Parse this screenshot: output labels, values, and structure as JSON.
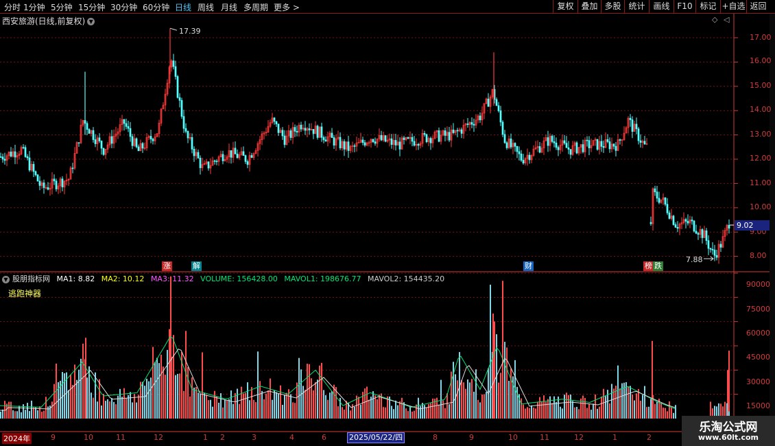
{
  "toolbar": {
    "periods": [
      "分时",
      "1分钟",
      "5分钟",
      "15分钟",
      "30分钟",
      "60分钟",
      "日线",
      "周线",
      "月线",
      "多周期",
      "更多 >"
    ],
    "active_period": "日线",
    "actions": [
      "复权",
      "叠加",
      "多股",
      "统计",
      "画线",
      "F10",
      "标记",
      "+自选",
      "返回"
    ]
  },
  "price_panel": {
    "title": "西安旅游(日线,前复权)",
    "high_label": "17.39",
    "low_label": "7.88",
    "current_price": "9.02",
    "y_ticks": [
      "17.00",
      "16.00",
      "15.00",
      "14.00",
      "13.00",
      "12.00",
      "11.00",
      "10.00",
      "9.00",
      "8.00"
    ],
    "markers": [
      {
        "text": "涨",
        "color": "#c62828"
      },
      {
        "text": "解",
        "color": "#00838f"
      },
      {
        "text": "财",
        "color": "#1565c0"
      },
      {
        "text": "榜",
        "color": "#c62828"
      },
      {
        "text": "跌",
        "color": "#2e7d32"
      }
    ]
  },
  "indicator_panel": {
    "title": "股朋指标网",
    "values": [
      {
        "label": "MA1: 8.82",
        "color": "#ffffff"
      },
      {
        "label": "MA2: 10.12",
        "color": "#ffff00"
      },
      {
        "label": "MA3: 11.32",
        "color": "#ff55ff"
      },
      {
        "label": "VOLUME: 156428.00",
        "color": "#00e676"
      },
      {
        "label": "MAVOL1: 198676.77",
        "color": "#00e676"
      },
      {
        "label": "MAVOL2: 154435.20",
        "color": "#cccccc"
      }
    ],
    "indicator_name": "逃跑神器",
    "y_ticks": [
      "90000",
      "75000",
      "60000",
      "45000",
      "30000",
      "15000"
    ]
  },
  "date_axis": {
    "labels": [
      "2024年",
      "9",
      "10",
      "11",
      "12",
      "1",
      "2",
      "3",
      "4",
      "6",
      "8",
      "9",
      "10",
      "11",
      "12",
      "1",
      "2"
    ],
    "cursor_date": "2025/05/22/四"
  },
  "watermark": {
    "title": "乐淘公式网",
    "url": "www.60lt.com"
  },
  "colors": {
    "up": "#ff3b3b",
    "down": "#54ffff",
    "grid": "#7a1515",
    "axis": "#d23c3c"
  }
}
